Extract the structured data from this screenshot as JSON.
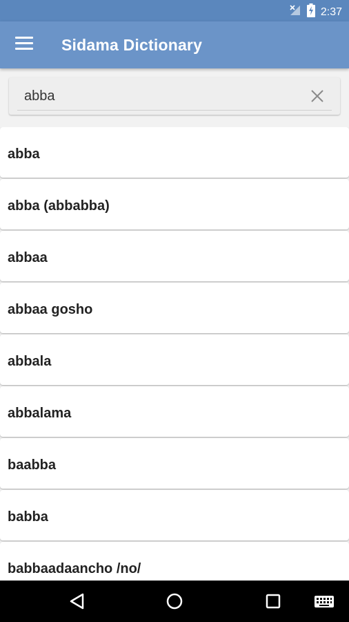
{
  "status_bar": {
    "time": "2:37",
    "icons": [
      "no-signal-icon",
      "battery-charging-icon"
    ]
  },
  "app_bar": {
    "title": "Sidama Dictionary",
    "menu_icon": "hamburger-menu-icon",
    "background": "#6b94c8"
  },
  "search": {
    "value": "abba",
    "clear_icon": "close-icon"
  },
  "results": [
    "abba",
    "abba (abbabba)",
    "abbaa",
    "abbaa gosho",
    "abbala",
    "abbalama",
    "baabba",
    "babba",
    "babbaadaancho /no/"
  ],
  "nav_bar": {
    "buttons": [
      "back-icon",
      "home-icon",
      "recents-icon",
      "keyboard-icon"
    ]
  }
}
